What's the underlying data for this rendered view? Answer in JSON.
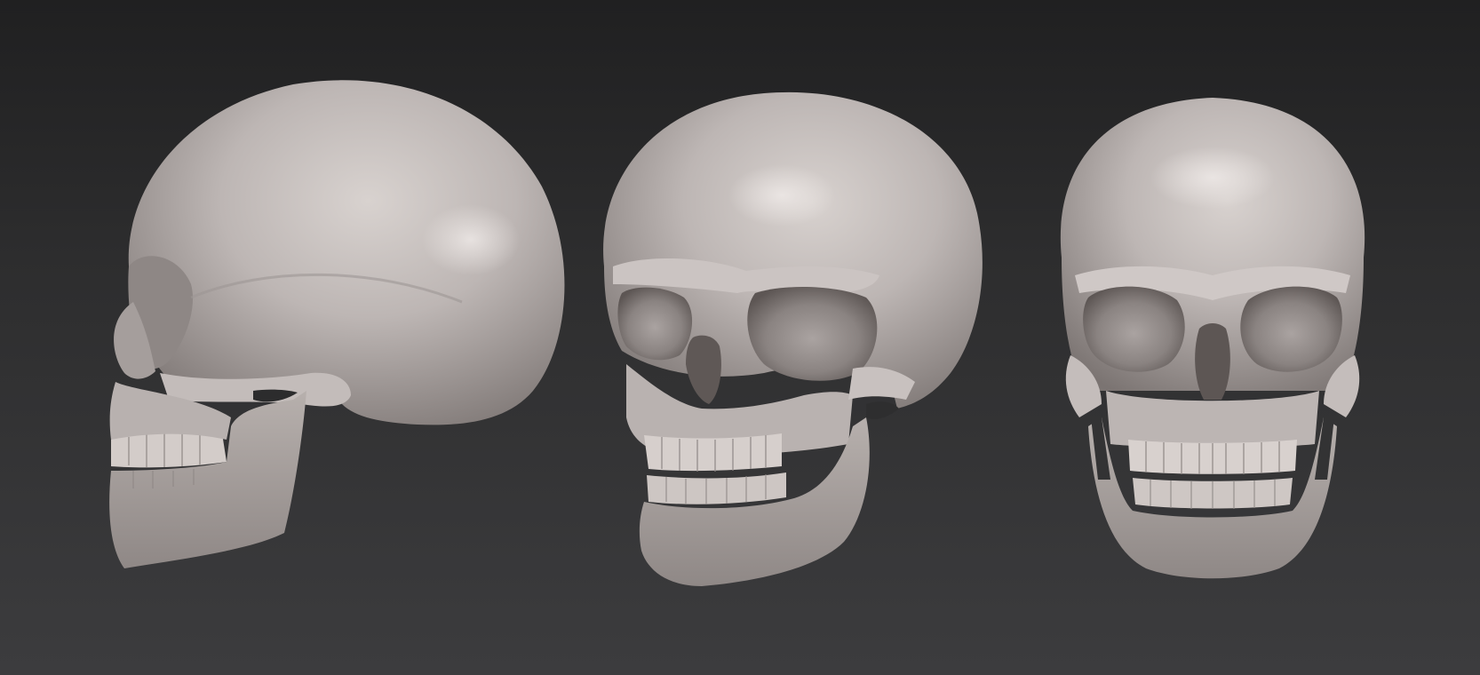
{
  "scene": {
    "background_top": "#202021",
    "background_bottom": "#3c3c3e",
    "material_color": "#bdb6b4",
    "material_shadow": "#6f6866",
    "objects": [
      {
        "id": "skull-side",
        "view": "side profile",
        "icon": "skull-side-view"
      },
      {
        "id": "skull-three-quarter",
        "view": "three-quarter",
        "icon": "skull-three-quarter-view"
      },
      {
        "id": "skull-front",
        "view": "front",
        "icon": "skull-front-view"
      }
    ]
  }
}
